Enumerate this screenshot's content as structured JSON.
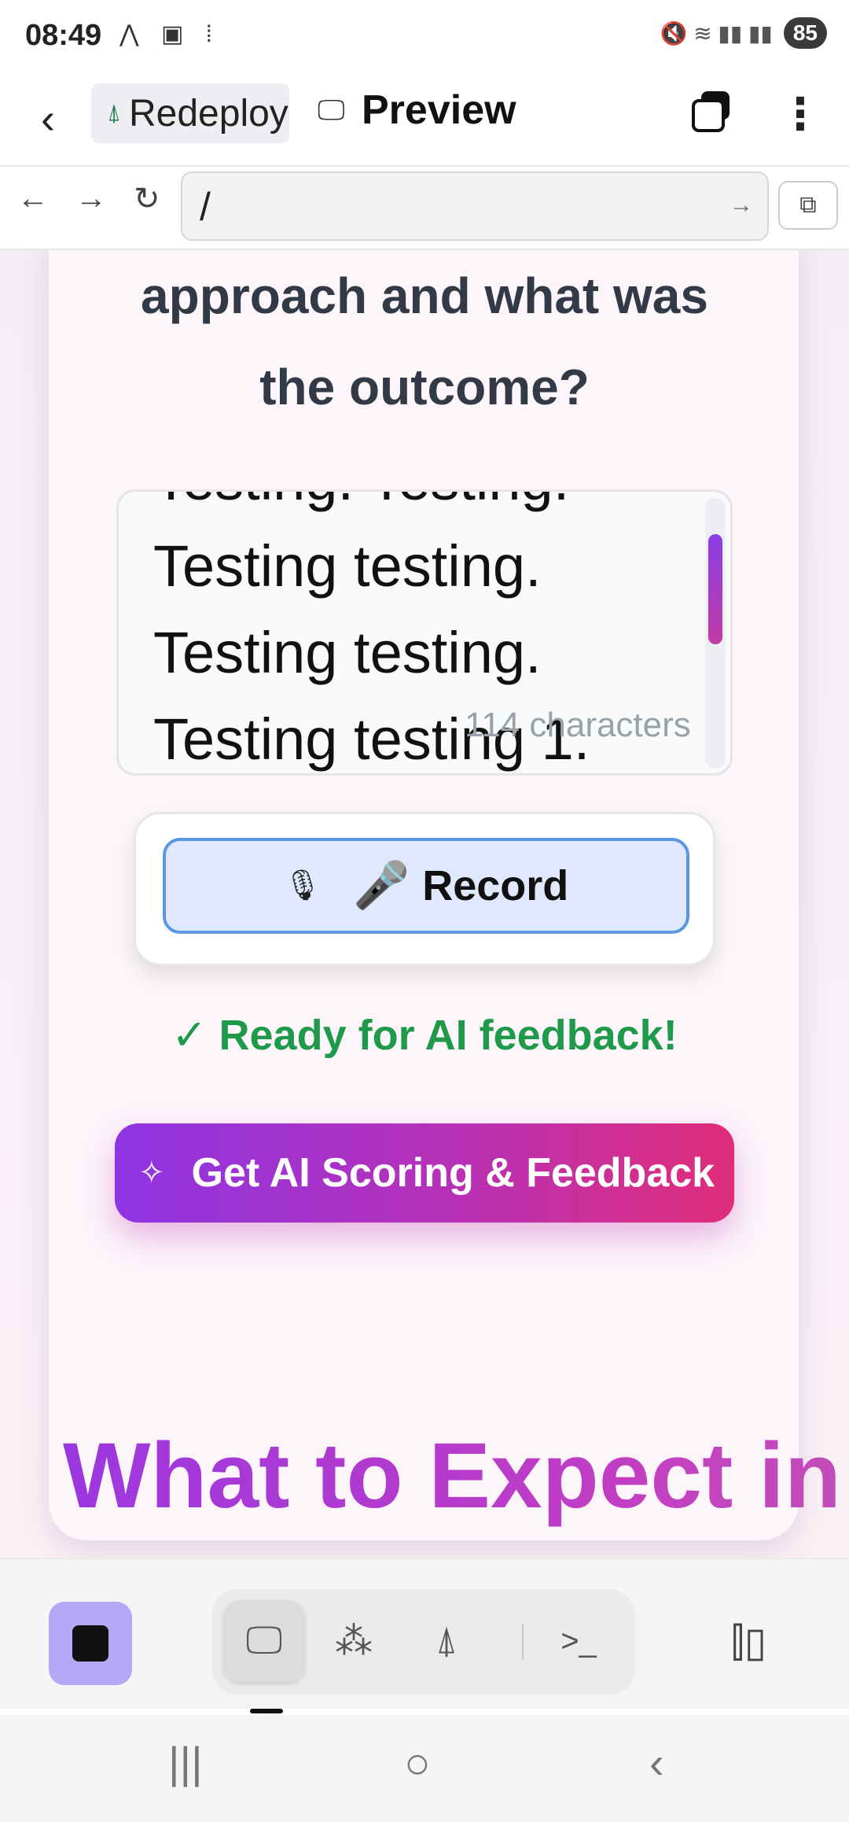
{
  "status_bar": {
    "time": "08:49",
    "left_icons": "⋀ ▣ ⁞",
    "right_icons": "🔇 ≋ ▮▮ ▮▮",
    "battery": "85"
  },
  "app_bar": {
    "back_icon": "‹",
    "tab_redeploy_label": "Redeploy",
    "tab_preview_label": "Preview",
    "more_icon": "⋮"
  },
  "browser": {
    "back": "←",
    "forward": "→",
    "reload": "↻",
    "url": "/",
    "go": "→",
    "open_external": "⧉"
  },
  "question": {
    "line1": "approach and what was",
    "line2": "the outcome?"
  },
  "answer": {
    "text": "Testing. Testing. Testing testing. Testing testing. Testing testing 1.",
    "char_count": "114 characters"
  },
  "record": {
    "mic_icon": "🎙",
    "emoji": "🎤",
    "label": "Record"
  },
  "status_message": "✓ Ready for AI feedback!",
  "ai_button": {
    "icon": "✧",
    "label": "Get AI Scoring & Feedback"
  },
  "section_heading": "What to Expect in",
  "toolbar": {
    "modes": [
      {
        "name": "monitor-icon",
        "glyph": "🖵"
      },
      {
        "name": "grid-icon",
        "glyph": "⁂"
      },
      {
        "name": "deploy-icon",
        "glyph": "⍋"
      },
      {
        "name": "terminal-icon",
        "glyph": ">_"
      }
    ],
    "side_icon": "⫿▯"
  },
  "system_nav": {
    "recents": "|||",
    "home": "○",
    "back": "‹"
  },
  "colors": {
    "accent_purple": "#8e34e4",
    "accent_pink": "#e02d7a",
    "success_green": "#1f9a4b",
    "record_blue": "#5b95e6"
  }
}
